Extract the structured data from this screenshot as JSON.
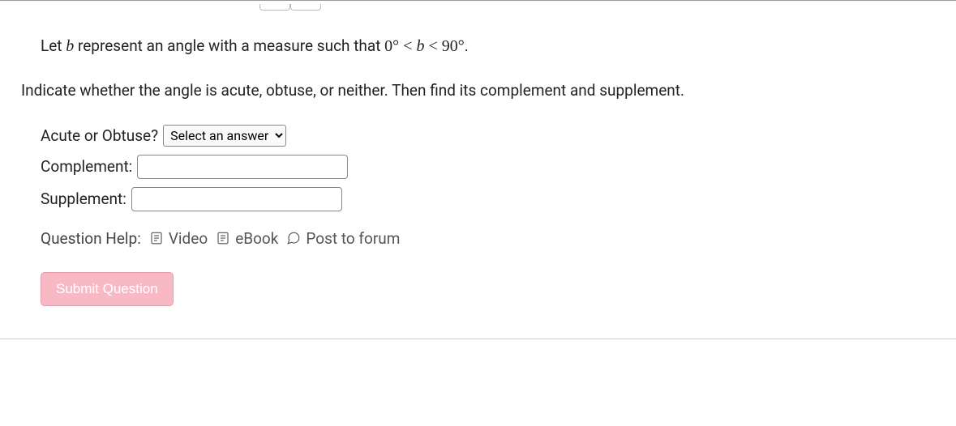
{
  "question": {
    "line1_pre": "Let ",
    "line1_var": "b",
    "line1_mid": " represent an angle with a measure such that ",
    "line1_math": "0° < b < 90°",
    "line1_post": ".",
    "line2": "Indicate whether the angle is acute, obtuse, or neither. Then find its complement and supplement."
  },
  "form": {
    "q1_label": "Acute or Obtuse?",
    "q1_placeholder": "Select an answer",
    "q2_label": "Complement:",
    "q3_label": "Supplement:"
  },
  "help": {
    "label": "Question Help:",
    "video": "Video",
    "ebook": "eBook",
    "forum": "Post to forum"
  },
  "submit_label": "Submit Question"
}
